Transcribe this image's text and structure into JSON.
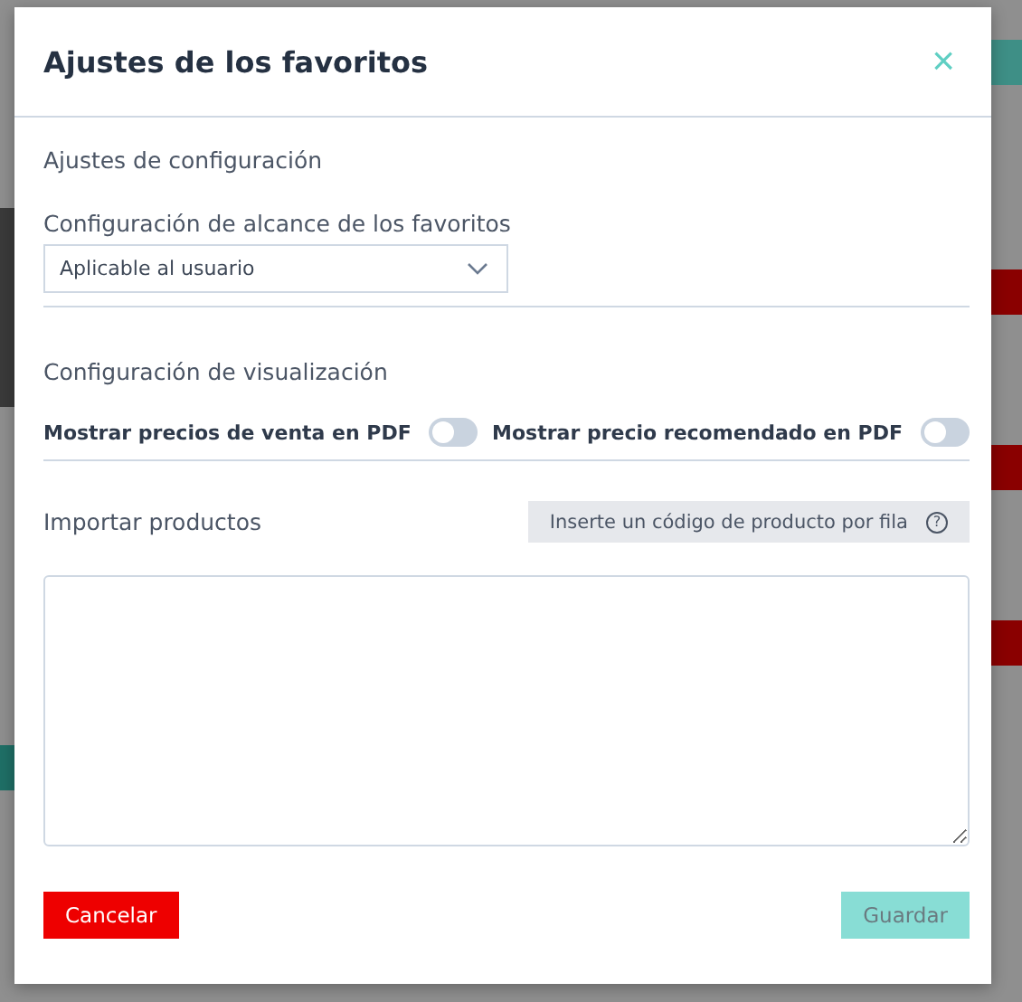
{
  "dialog": {
    "title": "Ajustes de los favoritos",
    "close": "×"
  },
  "settings_section": {
    "heading": "Ajustes de configuración",
    "scope": {
      "label": "Configuración de alcance de los favoritos",
      "value": "Aplicable al usuario"
    }
  },
  "display_section": {
    "heading": "Configuración de visualización",
    "toggles": [
      {
        "label": "Mostrar precios de venta en PDF",
        "on": false
      },
      {
        "label": "Mostrar precio recomendado en PDF",
        "on": false
      }
    ]
  },
  "import_section": {
    "heading": "Importar productos",
    "hint": "Inserte un código de producto por fila",
    "hint_icon": "?"
  },
  "buttons": [
    {
      "kind": "cancel",
      "label": "Cancelar",
      "disabled": false
    },
    {
      "kind": "save",
      "label": "Guardar",
      "disabled": true
    }
  ]
}
